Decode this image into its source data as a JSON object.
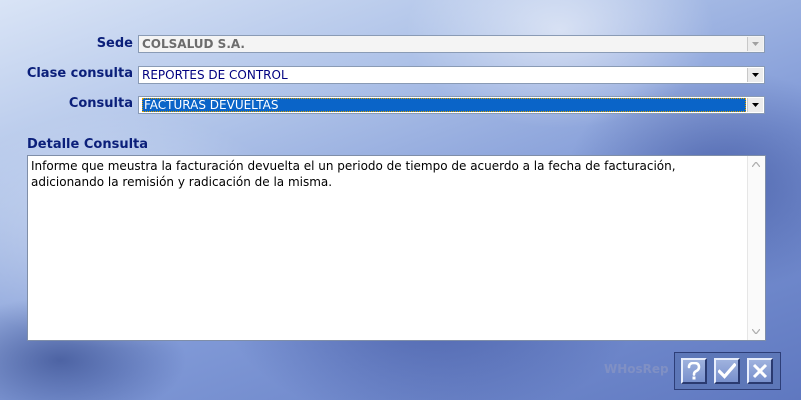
{
  "form": {
    "sede": {
      "label": "Sede",
      "value": "COLSALUD S.A."
    },
    "clase_consulta": {
      "label": "Clase consulta",
      "value": "REPORTES DE CONTROL"
    },
    "consulta": {
      "label": "Consulta",
      "value": "FACTURAS DEVUELTAS"
    },
    "detalle": {
      "label": "Detalle Consulta",
      "text": "Informe que meustra la facturación devuelta el un periodo de tiempo de acuerdo a la fecha de facturación, adicionando la remisión y radicación de la misma."
    }
  },
  "footer": {
    "app_name": "WHosRep",
    "buttons": [
      {
        "name": "help",
        "icon": "question-icon"
      },
      {
        "name": "accept",
        "icon": "check-icon"
      },
      {
        "name": "cancel",
        "icon": "close-icon"
      }
    ]
  },
  "colors": {
    "label": "#0b1f7a",
    "selection": "#0a64c8",
    "toolbar": "#5d77b8"
  }
}
